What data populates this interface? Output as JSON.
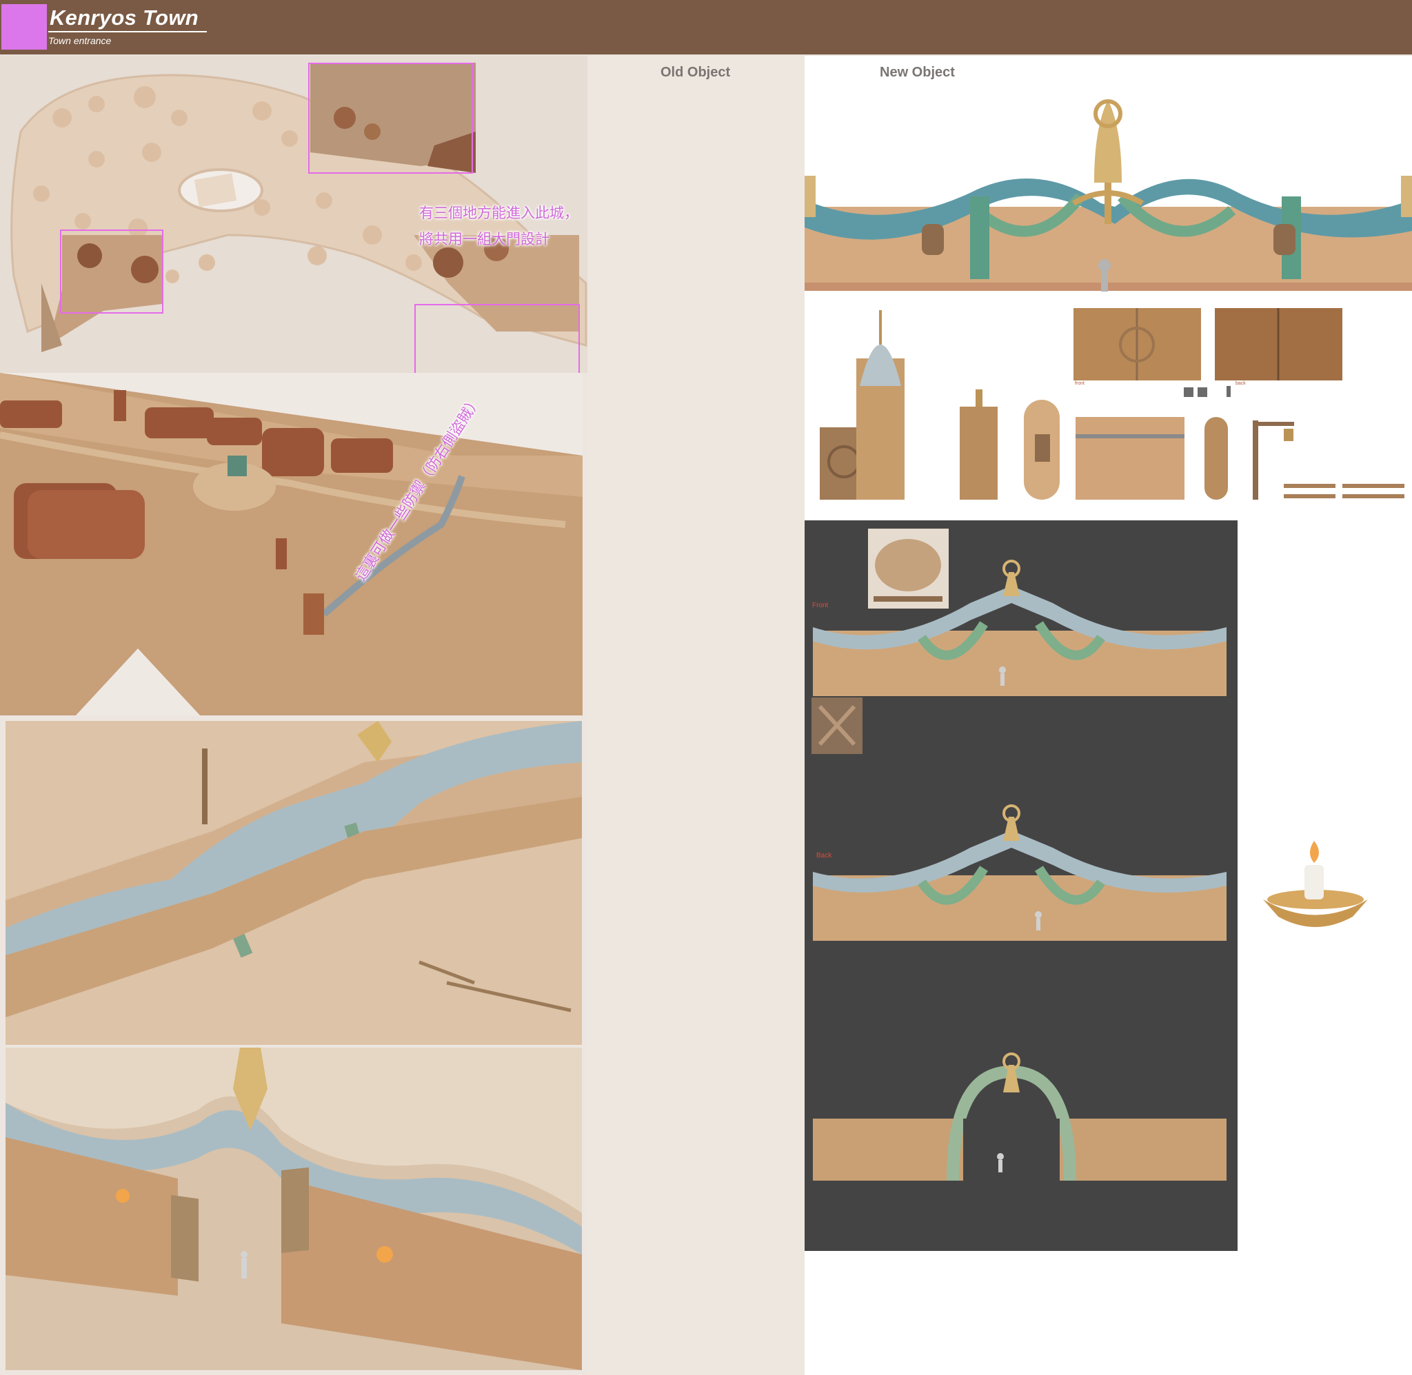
{
  "header": {
    "title": "Kenryos Town",
    "subtitle": "Town entrance",
    "swatch_color": "#db77ea",
    "bar_color": "#7a5a45"
  },
  "columns": {
    "old_object": "Old Object",
    "new_object": "New Object"
  },
  "annotations": {
    "note_line1": "有三個地方能進入此城，",
    "note_line2": "將共用一組大門設計",
    "note_diagonal": "這裏可做一些防禦（防右側盜賊）",
    "highlight_color": "#e56bea"
  },
  "sheet_labels": {
    "door_front": "front",
    "door_back": "back",
    "gate_front": "Front",
    "gate_back": "Back"
  }
}
